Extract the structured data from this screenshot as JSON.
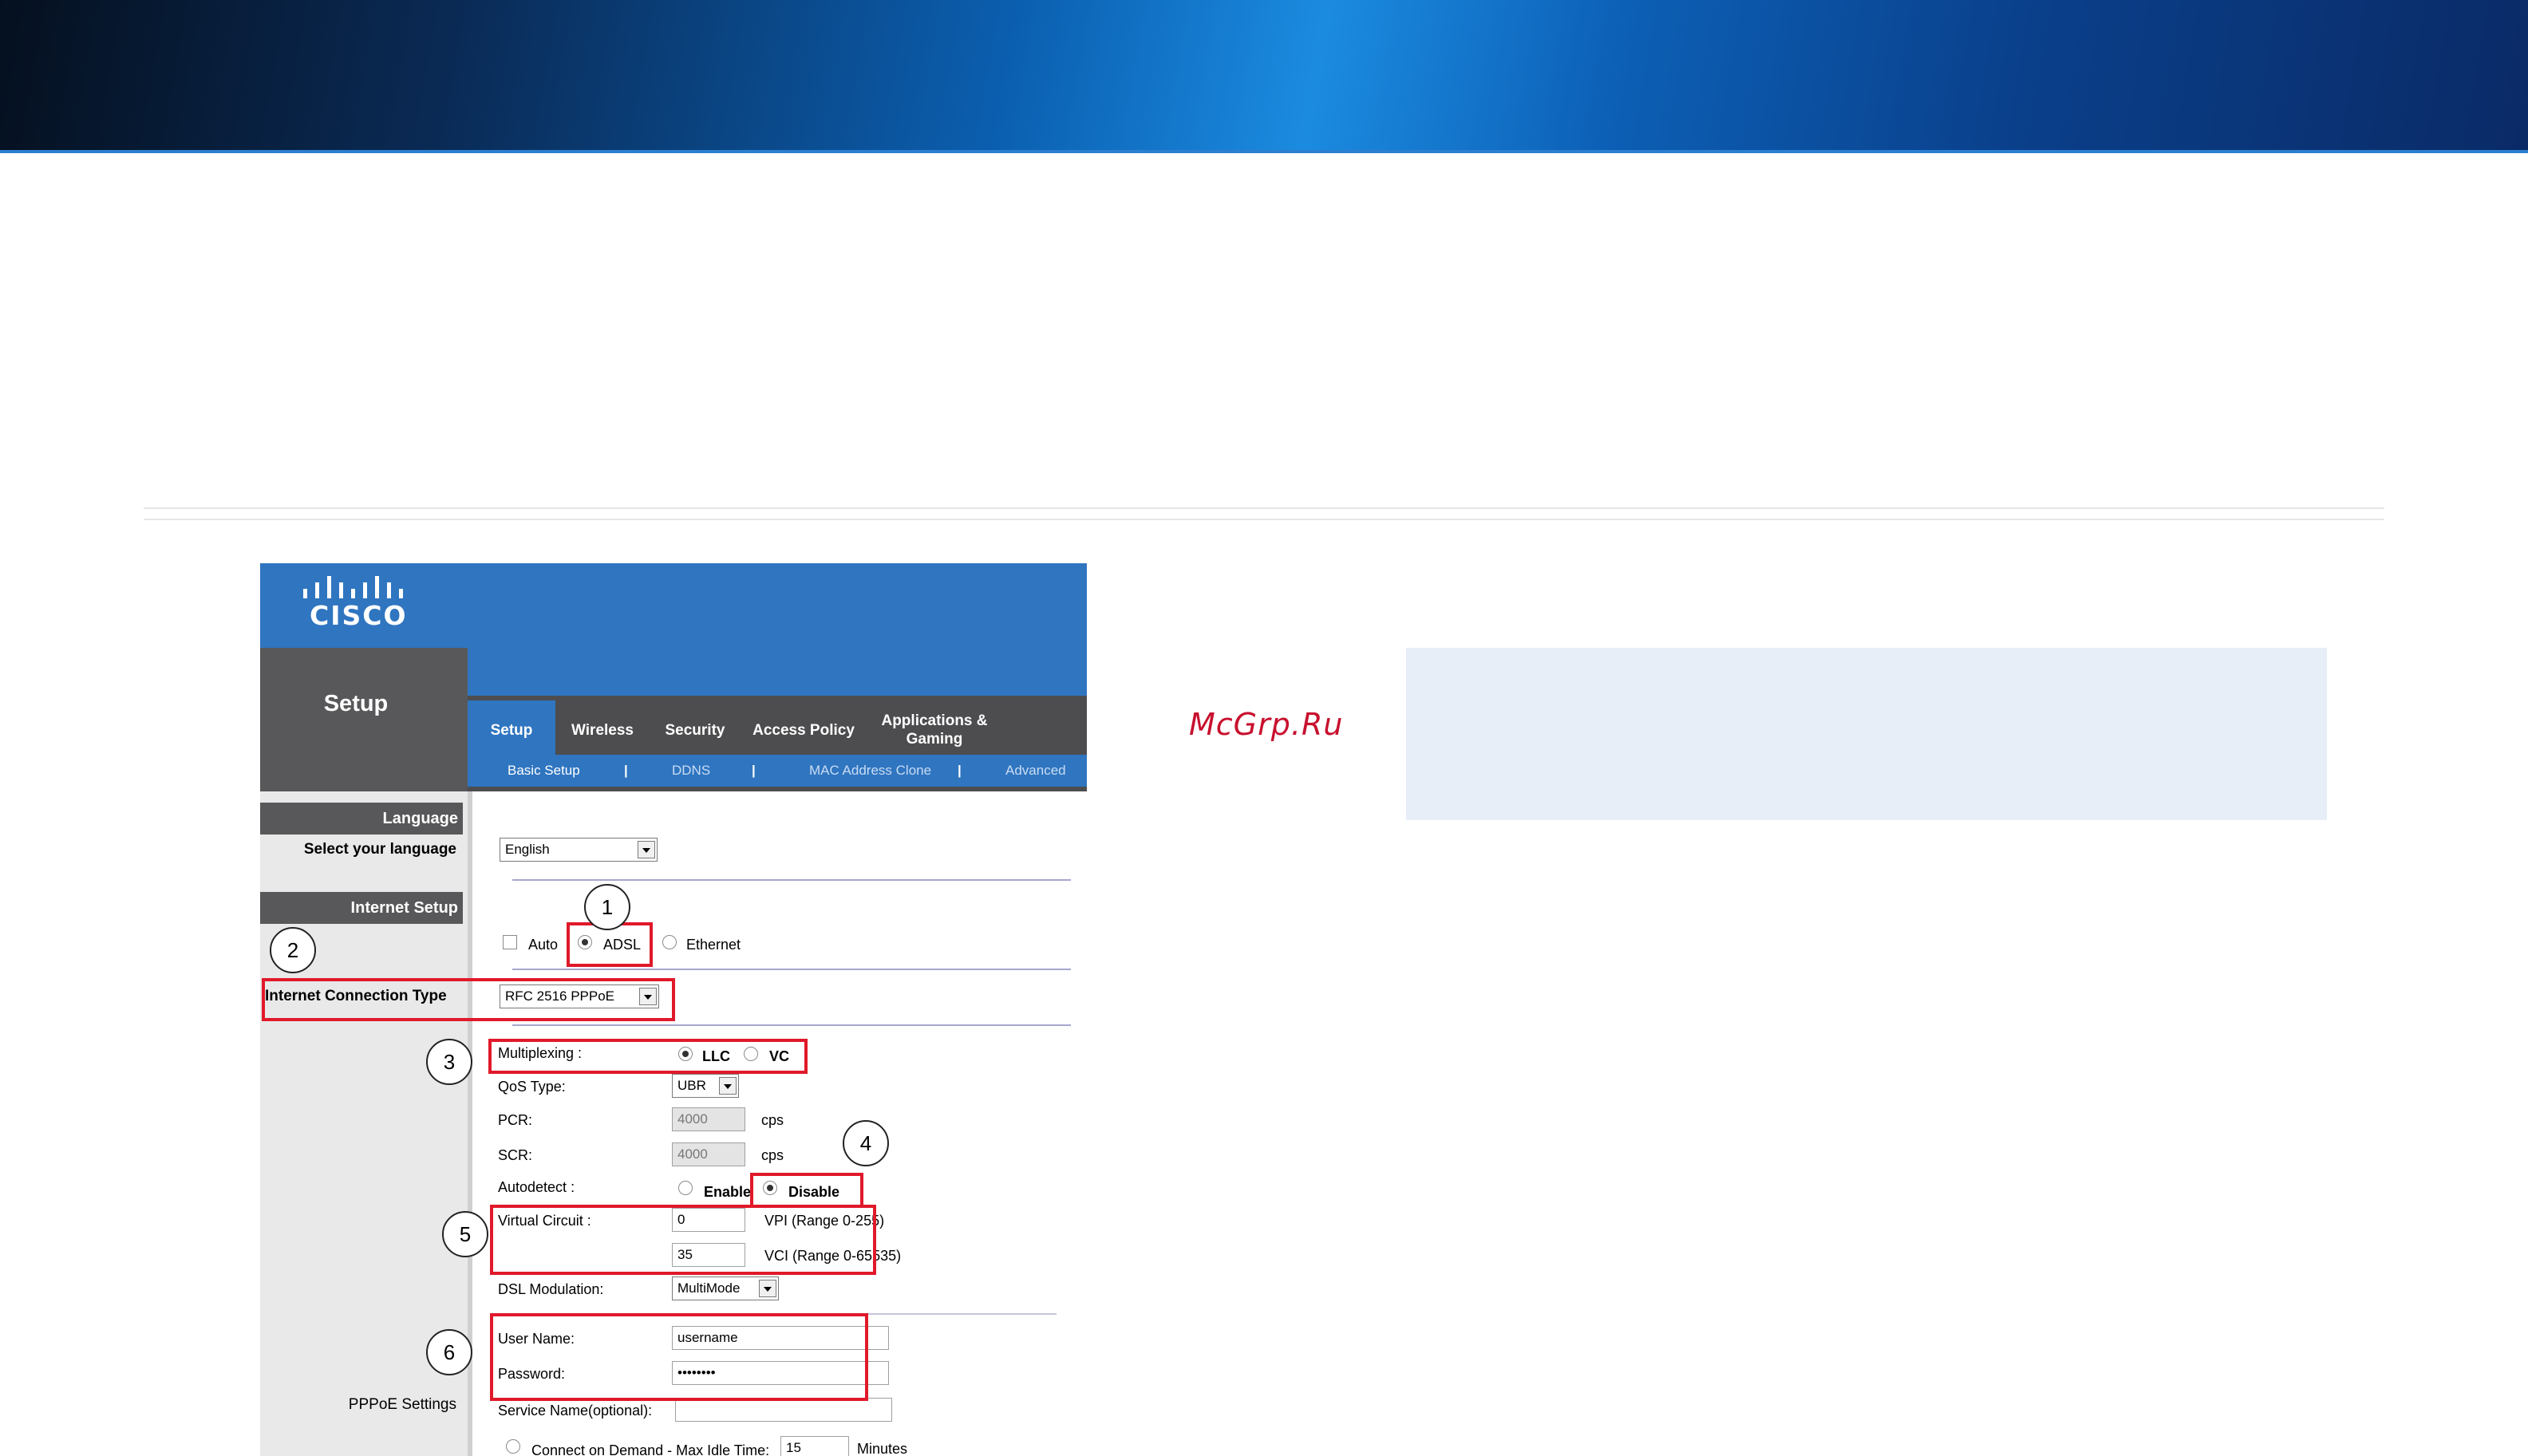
{
  "brand": {
    "logo_text": "CISCO",
    "watermark": "McGrp.Ru"
  },
  "router": {
    "section_title": "Setup",
    "tabs": [
      {
        "label": "Setup",
        "active": true
      },
      {
        "label": "Wireless"
      },
      {
        "label": "Security"
      },
      {
        "label": "Access Policy"
      },
      {
        "label": "Applications &\nGaming"
      }
    ],
    "subtabs": [
      {
        "label": "Basic Setup",
        "active": true
      },
      {
        "label": "DDNS"
      },
      {
        "label": "MAC Address Clone"
      },
      {
        "label": "Advanced"
      }
    ],
    "subtab_separator": "|",
    "language": {
      "header": "Language",
      "label": "Select your language",
      "value": "English"
    },
    "internet_setup": {
      "header": "Internet Setup",
      "mode_options": {
        "auto": "Auto",
        "adsl": "ADSL",
        "ethernet": "Ethernet"
      },
      "selected_mode": "ADSL",
      "connection_type_label": "Internet Connection Type",
      "connection_type_value": "RFC 2516 PPPoE"
    },
    "adsl": {
      "multiplexing_label": "Multiplexing :",
      "multiplexing_options": [
        "LLC",
        "VC"
      ],
      "multiplexing_selected": "LLC",
      "qos_label": "QoS Type:",
      "qos_value": "UBR",
      "pcr_label": "PCR:",
      "pcr_value": "4000",
      "pcr_unit": "cps",
      "scr_label": "SCR:",
      "scr_value": "4000",
      "scr_unit": "cps",
      "autodetect_label": "Autodetect :",
      "autodetect_options": [
        "Enable",
        "Disable"
      ],
      "autodetect_selected": "Disable",
      "virtual_circuit_label": "Virtual Circuit :",
      "vpi_value": "0",
      "vpi_note": "VPI (Range 0-255)",
      "vci_value": "35",
      "vci_note": "VCI (Range 0-65535)",
      "dsl_modulation_label": "DSL Modulation:",
      "dsl_modulation_value": "MultiMode"
    },
    "pppoe": {
      "section_label": "PPPoE Settings",
      "username_label": "User Name:",
      "username_value": "username",
      "password_label": "Password:",
      "password_value": "••••••••",
      "service_name_label": "Service Name(optional):",
      "service_name_value": "",
      "connect_on_demand_label": "Connect on Demand - Max Idle Time:",
      "max_idle_value": "15",
      "max_idle_unit": "Minutes"
    }
  },
  "callouts": [
    "1",
    "2",
    "3",
    "4",
    "5",
    "6"
  ],
  "colors": {
    "cisco_blue": "#2f75c0",
    "dark_grey": "#58585a",
    "highlight_red": "#e0192a",
    "note_bg": "#e8eef8",
    "watermark_red": "#c8102e"
  }
}
